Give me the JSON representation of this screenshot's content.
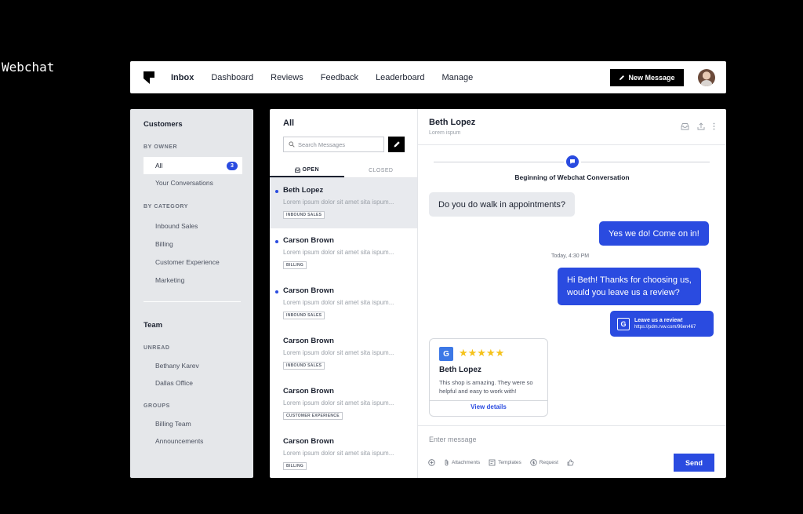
{
  "page_label": "Webchat",
  "nav": {
    "items": [
      "Inbox",
      "Dashboard",
      "Reviews",
      "Feedback",
      "Leaderboard",
      "Manage"
    ],
    "active": "Inbox",
    "new_message_label": "New Message"
  },
  "sidebar": {
    "customers_heading": "Customers",
    "by_owner_label": "BY OWNER",
    "all_label": "All",
    "all_count": "3",
    "your_conversations": "Your Conversations",
    "by_category_label": "BY CATEGORY",
    "categories": [
      "Inbound Sales",
      "Billing",
      "Customer Experience",
      "Marketing"
    ],
    "team_heading": "Team",
    "unread_label": "UNREAD",
    "unread_items": [
      "Bethany Karev",
      "Dallas Office"
    ],
    "groups_label": "GROUPS",
    "groups": [
      "Billing Team",
      "Announcements"
    ]
  },
  "list": {
    "title": "All",
    "search_placeholder": "Search Messages",
    "tab_open": "OPEN",
    "tab_closed": "CLOSED",
    "conversations": [
      {
        "name": "Beth Lopez",
        "preview": "Lorem ipsum dolor sit amet sita ispum...",
        "tag": "INBOUND SALES"
      },
      {
        "name": "Carson Brown",
        "preview": "Lorem ipsum dolor sit amet sita ispum...",
        "tag": "BILLING"
      },
      {
        "name": "Carson Brown",
        "preview": "Lorem ipsum dolor sit amet sita ispum...",
        "tag": "INBOUND SALES"
      },
      {
        "name": "Carson Brown",
        "preview": "Lorem ipsum dolor sit amet sita ispum...",
        "tag": "INBOUND SALES"
      },
      {
        "name": "Carson Brown",
        "preview": "Lorem ipsum dolor sit amet sita ispum...",
        "tag": "CUSTOMER EXPERIENCE"
      },
      {
        "name": "Carson Brown",
        "preview": "Lorem ipsum dolor sit amet sita ispum...",
        "tag": "BILLING"
      }
    ]
  },
  "chat": {
    "contact_name": "Beth Lopez",
    "contact_sub": "Lorem ispum",
    "beginning_text": "Beginning of Webchat Conversation",
    "msg1": "Do you do walk in appointments?",
    "msg2": "Yes we do! Come on in!",
    "timestamp": "Today, 4:30 PM",
    "msg3_line1": "Hi Beth! Thanks for choosing us,",
    "msg3_line2": "would you leave us a review?",
    "review_link_title": "Leave us a review!",
    "review_link_url": "https://pdm.rvw.com/96en467",
    "review_card": {
      "g": "G",
      "stars": "★★★★★",
      "name": "Beth Lopez",
      "text": "This shop is amazing. They were so helpful and easy to work with!",
      "link": "View details"
    },
    "composer_placeholder": "Enter message",
    "tool_attachments": "Attachments",
    "tool_templates": "Templates",
    "tool_request": "Request",
    "send_label": "Send"
  },
  "colors": {
    "accent": "#2a4be0",
    "star": "#f5c21b",
    "sidebar_bg": "#e5e7ea"
  }
}
